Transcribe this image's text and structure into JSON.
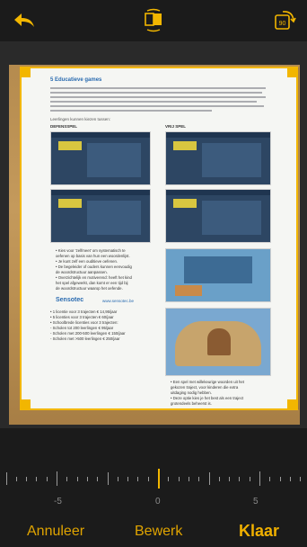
{
  "toolbar": {
    "back_icon": "back-arrow-icon",
    "filter_icon": "color-filter-icon",
    "rotate_icon": "rotate-90-icon",
    "rotate_label": "90"
  },
  "document": {
    "heading": "5 Educatieve games",
    "left_column_title": "DEFENSSPEL",
    "right_column_title": "VRIJ SPEL",
    "learn_label": "Leerlingen kunnen kiezen tussen:",
    "brand": "Sensotec",
    "brand_url": "www.sensotec.be",
    "bullets_left": [
      "• Kies voor 'zelfmeet' om systematisch te",
      "  oefenen op basis van hun een woordenlijst.",
      "• Je kunt zelf een ouditieve oefenen.",
      "• De begeleider of ouders kunnen eenvoudig",
      "  de woordstructuur aanpassen.",
      "• Overzichtelijk en motiverend: heeft het kind",
      "  het spel afgewerkt, dan komt er een tijd bij",
      "  de woordstructuur waarop het oefende."
    ],
    "pricing": [
      "• 1 licentie voor 3 trajecten        € 14,95/jaar",
      "• 5 licenties voor 3 trajecten       € 60/jaar",
      "• Schoolbrede licenties voor 3 trajecten:",
      "  - Scholen tot 200 leerlingen         € 95/jaar",
      "  - Scholen met 200-500 leerlingen     € 150/jaar",
      "  - Scholen met >500 leerlingen         € 250/jaar"
    ],
    "bullets_right": [
      "• Een spel met willekeurige woorden uit het",
      "  gekozen traject, voor kinderen die extra",
      "  uitdaging nodig hebben.",
      "• Deze optie kies je het best als een traject",
      "  grotendeels beheerst is."
    ]
  },
  "ruler": {
    "labels": [
      "-5",
      "0",
      "5"
    ],
    "value": 0
  },
  "actions": {
    "cancel": "Annuleer",
    "edit": "Bewerk",
    "done": "Klaar"
  },
  "colors": {
    "accent": "#f2b600",
    "background": "#1b1b1b"
  }
}
